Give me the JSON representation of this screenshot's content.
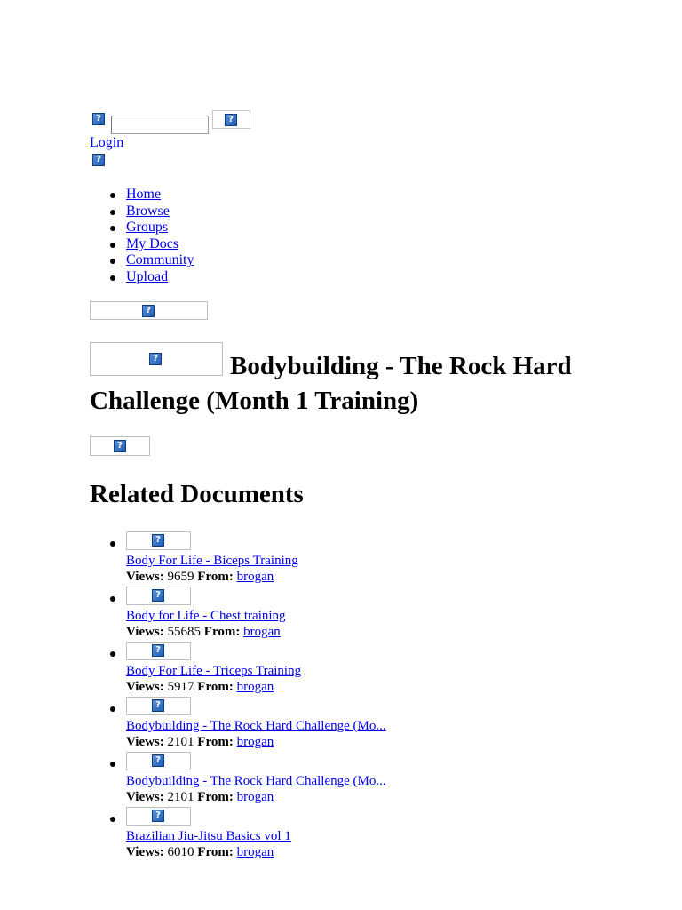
{
  "search": {
    "icon": "broken-image-icon",
    "placeholder": "",
    "value": "",
    "button_icon": "broken-image-icon"
  },
  "header": {
    "login_label": "Login",
    "login_icon": "broken-image-icon"
  },
  "nav": {
    "items": [
      {
        "label": "Home"
      },
      {
        "label": "Browse"
      },
      {
        "label": "Groups"
      },
      {
        "label": "My Docs"
      },
      {
        "label": "Community"
      },
      {
        "label": "Upload"
      }
    ]
  },
  "document": {
    "title": "Bodybuilding - The Rock Hard Challenge (Month 1 Training)"
  },
  "related": {
    "heading": "Related Documents",
    "views_label": "Views:",
    "from_label": "From:",
    "items": [
      {
        "title": "Body For Life - Biceps Training",
        "views": "9659",
        "from": "brogan"
      },
      {
        "title": "Body for Life - Chest training",
        "views": "55685",
        "from": "brogan"
      },
      {
        "title": "Body For Life - Triceps Training",
        "views": "5917",
        "from": "brogan"
      },
      {
        "title": "Bodybuilding - The Rock Hard Challenge (Mo...",
        "views": "2101",
        "from": "brogan"
      },
      {
        "title": "Bodybuilding - The Rock Hard Challenge (Mo...",
        "views": "2101",
        "from": "brogan"
      },
      {
        "title": "Brazilian Jiu-Jitsu Basics vol 1",
        "views": "6010",
        "from": "brogan"
      }
    ]
  },
  "icons": {
    "placeholder_glyph": "?",
    "accent": "#1f5fb5"
  }
}
